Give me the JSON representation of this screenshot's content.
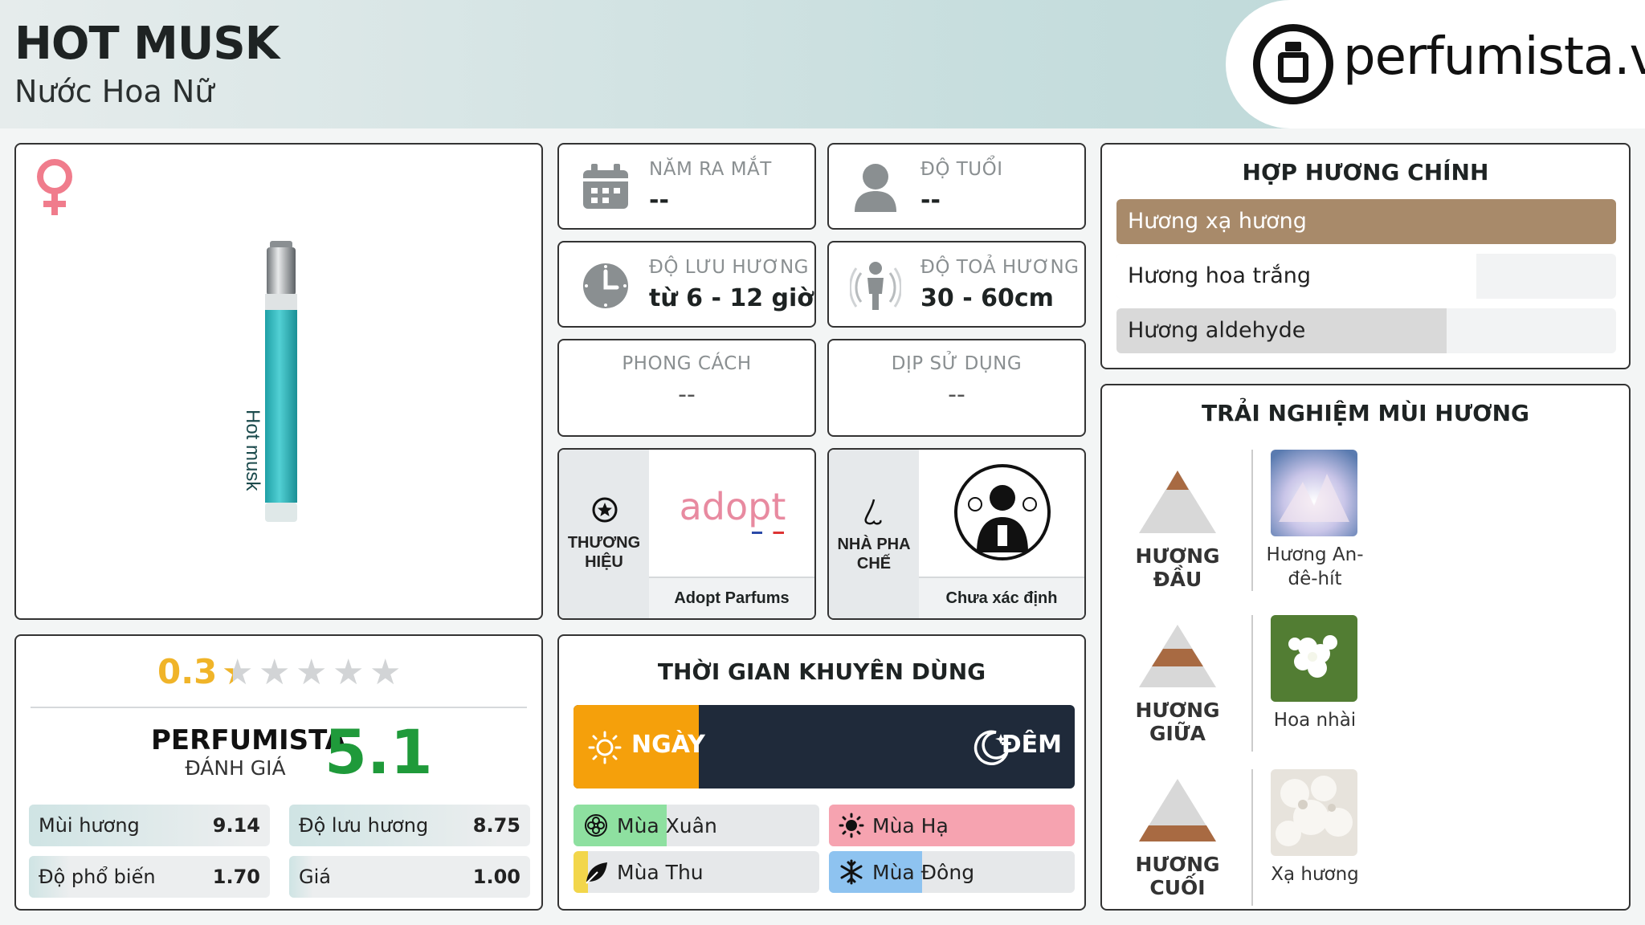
{
  "header": {
    "title": "HOT MUSK",
    "subtitle": "Nước Hoa Nữ",
    "brand_site": "perfumista.vn"
  },
  "product": {
    "gender_icon": "female-symbol-icon",
    "bottle_label": "Hot musk"
  },
  "info": {
    "launch_year": {
      "label": "NĂM RA MẮT",
      "value": "--",
      "icon": "calendar-icon"
    },
    "age": {
      "label": "ĐỘ TUỔI",
      "value": "--",
      "icon": "person-icon"
    },
    "longevity": {
      "label": "ĐỘ LƯU HƯƠNG",
      "value": "từ 6 - 12 giờ",
      "icon": "clock-icon"
    },
    "sillage": {
      "label": "ĐỘ TOẢ HƯƠNG",
      "value": "30 - 60cm",
      "icon": "sillage-person-icon"
    },
    "style": {
      "label": "PHONG CÁCH",
      "value": "--"
    },
    "occasion": {
      "label": "DỊP SỬ DỤNG",
      "value": "--"
    }
  },
  "brand": {
    "tag_line1": "THƯƠNG",
    "tag_line2": "HIỆU",
    "logo_text": "adopt",
    "name": "Adopt Parfums"
  },
  "perfumer": {
    "tag_line1": "NHÀ PHA",
    "tag_line2": "CHẾ",
    "name": "Chưa xác định"
  },
  "main_accords": {
    "title": "HỢP HƯƠNG CHÍNH",
    "items": [
      {
        "label": "Hương xạ hương",
        "strength": 1.0,
        "color": "#a88a6a"
      },
      {
        "label": "Hương hoa trắng",
        "strength": 0.72,
        "color": "#ffffff"
      },
      {
        "label": "Hương aldehyde",
        "strength": 0.66,
        "color": "#d9d9d9"
      }
    ]
  },
  "notes": {
    "title": "TRẢI NGHIỆM MÙI HƯƠNG",
    "groups": [
      {
        "level": "HƯƠNG ĐẦU",
        "notes": [
          {
            "name_line1": "Hương An-",
            "name_line2": "đê-hít"
          }
        ]
      },
      {
        "level": "HƯƠNG GIỮA",
        "notes": [
          {
            "name_line1": "Hoa nhài",
            "name_line2": ""
          }
        ]
      },
      {
        "level": "HƯƠNG CUỐI",
        "notes": [
          {
            "name_line1": "Xạ hương",
            "name_line2": ""
          }
        ]
      }
    ]
  },
  "rating": {
    "user_score": "0.3",
    "user_stars_fraction": 0.06,
    "pf_title": "PERFUMISTA",
    "pf_subtitle": "ĐÁNH GIÁ",
    "pf_score": "5.1",
    "metrics": [
      {
        "label": "Mùi hương",
        "value": "9.14",
        "fraction": 0.914
      },
      {
        "label": "Độ lưu hương",
        "value": "8.75",
        "fraction": 0.875
      },
      {
        "label": "Độ phổ biến",
        "value": "1.70",
        "fraction": 0.17
      },
      {
        "label": "Giá",
        "value": "1.00",
        "fraction": 0.1
      }
    ]
  },
  "time_of_use": {
    "title": "THỜI GIAN KHUYÊN DÙNG",
    "day_label": "NGÀY",
    "night_label": "ĐÊM",
    "day_fraction": 0.25,
    "seasons": [
      {
        "label": "Mùa Xuân",
        "fraction": 0.38,
        "color": "#8ee0a0",
        "icon": "flower-icon"
      },
      {
        "label": "Mùa Hạ",
        "fraction": 1.0,
        "color": "#f6a3b0",
        "icon": "sun-icon"
      },
      {
        "label": "Mùa Thu",
        "fraction": 0.06,
        "color": "#f2d64b",
        "icon": "leaf-icon"
      },
      {
        "label": "Mùa Đông",
        "fraction": 0.38,
        "color": "#8ec3f0",
        "icon": "snowflake-icon"
      }
    ]
  },
  "colors": {
    "score_green": "#1f9a3a",
    "star_yellow": "#f0b429",
    "day_orange": "#f5a00b",
    "night_navy": "#1f2a3a"
  }
}
